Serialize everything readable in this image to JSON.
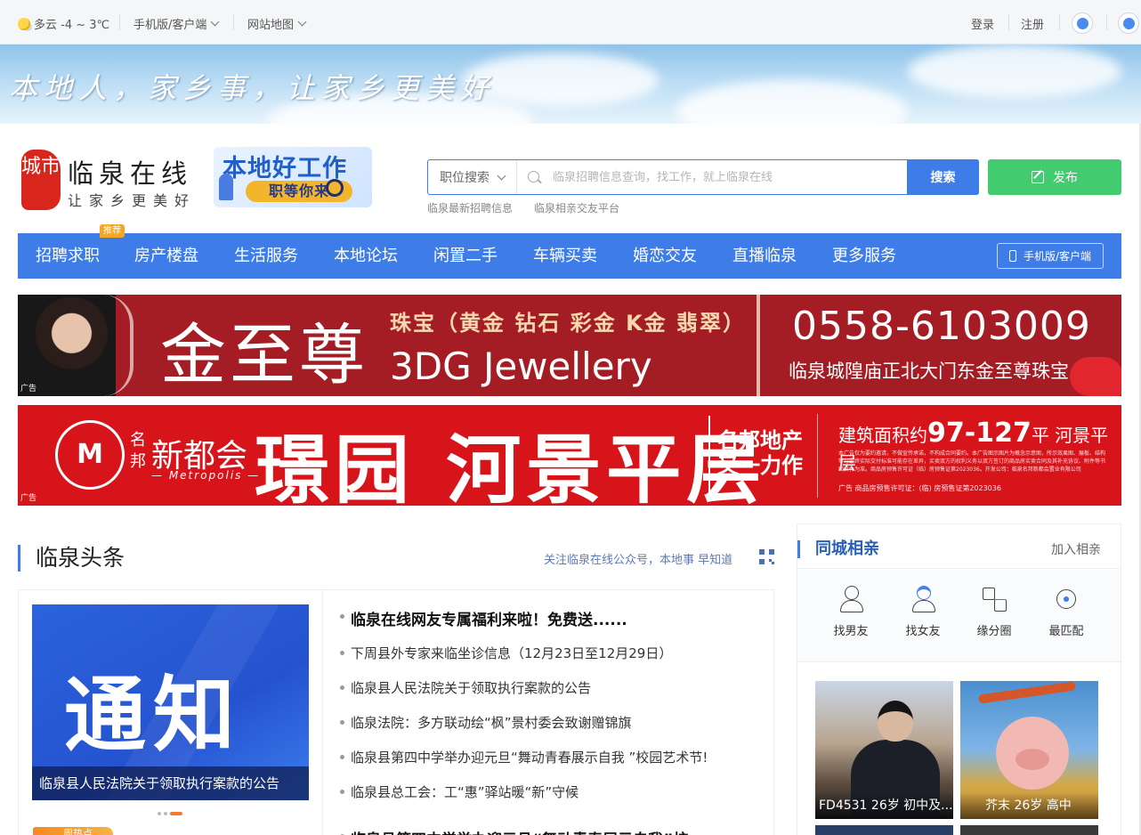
{
  "topbar": {
    "weather": "多云 -4 ~ 3℃",
    "mobile": "手机版/客户端",
    "sitemap": "网站地图",
    "login": "登录",
    "register": "注册"
  },
  "banner": {
    "slogan": "本地人，家乡事，让家乡更美好"
  },
  "logo": {
    "badge": "城市",
    "title": "临泉在线",
    "subtitle": "让家乡更美好"
  },
  "job_promo": {
    "line1": "本地好工作",
    "line2": "职等你来"
  },
  "search": {
    "category": "职位搜索",
    "placeholder": "临泉招聘信息查询，找工作，就上临泉在线",
    "button": "搜索",
    "hotlinks": [
      "临泉最新招聘信息",
      "临泉相亲交友平台"
    ]
  },
  "publish": "发布",
  "nav": {
    "items": [
      "招聘求职",
      "房产楼盘",
      "生活服务",
      "本地论坛",
      "闲置二手",
      "车辆买卖",
      "婚恋交友",
      "直播临泉",
      "更多服务"
    ],
    "tag": "推荐",
    "mobile_button": "手机版/客户端"
  },
  "ad1": {
    "brand": "金至尊",
    "line": "珠宝（黄金 钻石 彩金 K金 翡翠）",
    "english": "3DG Jewellery",
    "phone": "0558-6103009",
    "address": "临泉城隍庙正北大门东金至尊珠宝",
    "tag": "广告"
  },
  "ad2": {
    "logo": "M",
    "mingbang": "名邦",
    "name": "新都会",
    "metropolis": "— Metropolis —",
    "headline": "璟园 河景平层",
    "slogan1": "名邦地产",
    "slogan2": "又一力作",
    "area_prefix": "建筑面积约",
    "area_number": "97-127",
    "area_suffix": "平 河景平层",
    "fine_print": "本广告仅为要约邀请，不做宣传承诺，不构成合同要约。本广告图示图片为概念示意图，所示效果图、展板、结构等与最终实际交付标准可能存在差异，买卖双方的权利义务以双方签订的商品房买卖合同及其补充协议、附件等书面文件为准。商品房预售许可证（临）房预售证第2023036。开发公司：临泉名邦新都会置业有限公司",
    "permit": "广告 商品房预售许可证：(临) 房预售证第2023036",
    "tag": "广告"
  },
  "headlines": {
    "title": "临泉头条",
    "follow": "关注临泉在线公众号，本地事 早知道",
    "slide_text": "通知",
    "slide_caption": "临泉县人民法院关于领取执行案款的公告",
    "hot_badge": "周热点",
    "items": [
      "临泉在线网友专属福利来啦！免费送......",
      "下周县外专家来临坐诊信息（12月23日至12月29日）",
      "临泉县人民法院关于领取执行案款的公告",
      "临泉法院：多方联动绘“枫”景村委会致谢赠锦旗",
      "临泉县第四中学举办迎元旦“舞动青春展示自我 ”校园艺术节!",
      "临泉县总工会：工“惠”驿站暖“新”守候",
      "临泉县第四中学举办迎元旦“舞动青春展示自我”校"
    ]
  },
  "dating": {
    "title": "同城相亲",
    "join": "加入相亲",
    "actions": [
      "找男友",
      "找女友",
      "缘分圈",
      "最匹配"
    ],
    "cards": [
      "FD4531 26岁 初中及...",
      "芥末 26岁 高中"
    ]
  }
}
